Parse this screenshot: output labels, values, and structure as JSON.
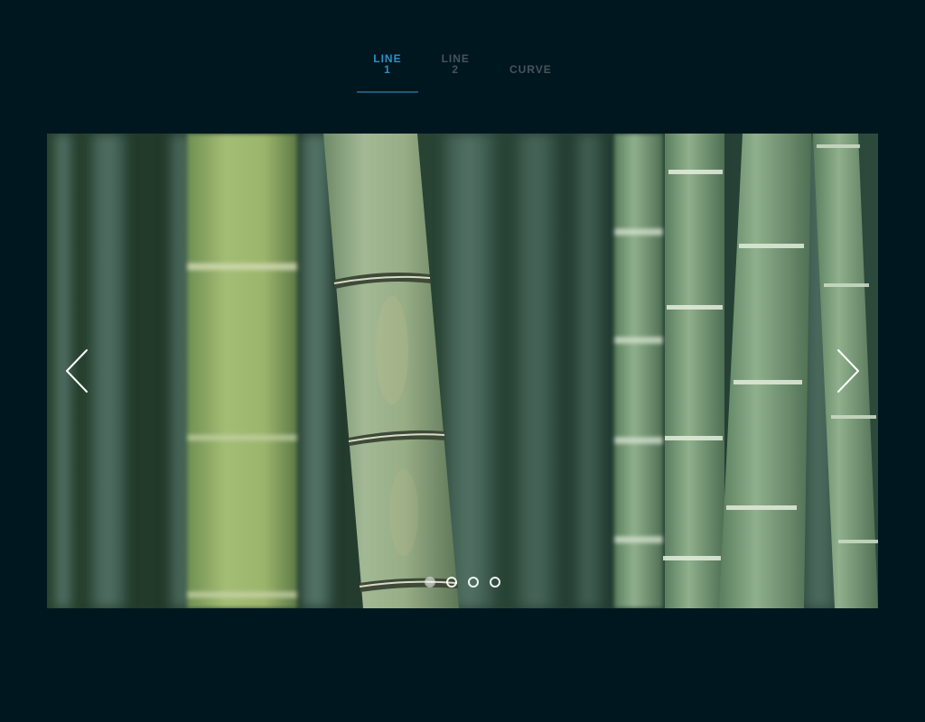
{
  "tabs": [
    {
      "line1": "LINE",
      "line2": "1",
      "active": true
    },
    {
      "line1": "LINE",
      "line2": "2",
      "active": false
    },
    {
      "line1": "CURVE",
      "line2": "",
      "active": false
    }
  ],
  "slider": {
    "image_subject": "bamboo forest",
    "prev_icon": "chevron-left-icon",
    "next_icon": "chevron-right-icon",
    "slide_count": 4,
    "active_index": 0
  },
  "colors": {
    "background": "#011720",
    "active_tab": "#2f8fc4",
    "inactive_tab": "#46545a",
    "tab_underline": "#1e5878"
  }
}
